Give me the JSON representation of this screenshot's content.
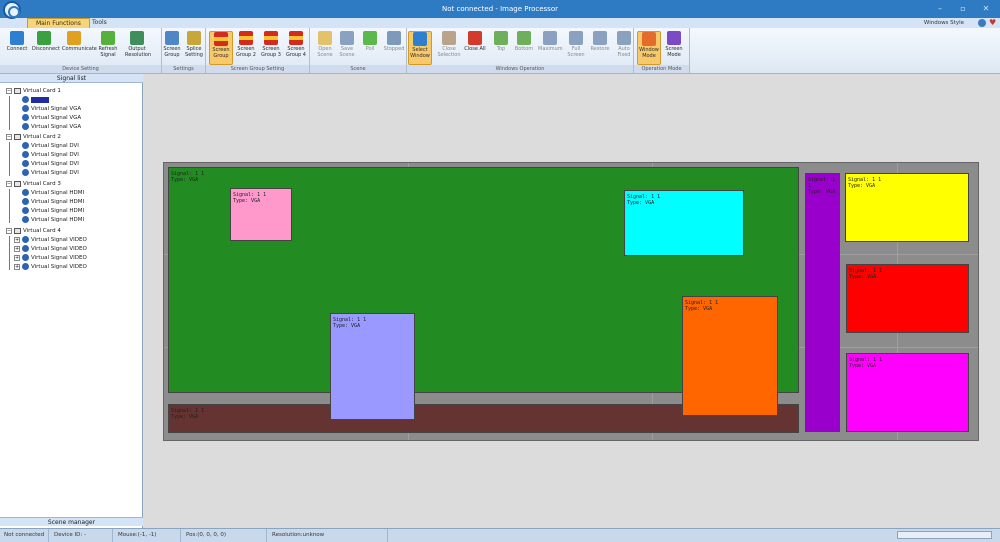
{
  "app": {
    "window_title": "Not connected - Image Processor",
    "min_glyph": "–",
    "max_glyph": "▫",
    "close_glyph": "✕"
  },
  "tabs": [
    "Main Functions",
    "Tools"
  ],
  "theme_label": "Windows Style",
  "ribbon": {
    "groups": [
      {
        "label": "Device Setting",
        "buttons": [
          {
            "label": "Connect",
            "icon": "globe-connect-icon",
            "color": "#2f7fd0"
          },
          {
            "label": "Disconnect",
            "icon": "globe-disconnect-icon",
            "color": "#3aa040"
          },
          {
            "label": "Communicate",
            "icon": "person-communicate-icon",
            "color": "#e0a020"
          },
          {
            "label": "Refresh Signal",
            "icon": "recycle-icon",
            "color": "#56b13c"
          },
          {
            "label": "Output Resolution",
            "icon": "resolution-grid-icon",
            "color": "#3f8f5a"
          }
        ]
      },
      {
        "label": "Settings",
        "buttons": [
          {
            "label": "Screen Group",
            "icon": "screen-group-icon",
            "color": "#4f86c6"
          },
          {
            "label": "Splice Setting",
            "icon": "splice-setting-icon",
            "color": "#c7a63a"
          }
        ]
      },
      {
        "label": "Screen Group Setting",
        "buttons": [
          {
            "label": "Screen Group",
            "icon": "flag-icon",
            "active": true
          },
          {
            "label": "Screen Group 2",
            "icon": "flag-icon"
          },
          {
            "label": "Screen Group 3",
            "icon": "flag-icon"
          },
          {
            "label": "Screen Group 4",
            "icon": "flag-icon"
          }
        ]
      },
      {
        "label": "Scene",
        "buttons": [
          {
            "label": "Open Scene",
            "icon": "folder-open-icon",
            "color": "#e3c26b",
            "dim": true
          },
          {
            "label": "Save Scene",
            "icon": "save-disk-icon",
            "color": "#8aa2bf",
            "dim": true
          },
          {
            "label": "Poll",
            "icon": "poll-cycle-icon",
            "color": "#5bb84b",
            "dim": true
          },
          {
            "label": "Stopped",
            "icon": "stop-icon",
            "color": "#7d9ab8",
            "dim": true
          }
        ]
      },
      {
        "label": "Windows Operation",
        "buttons": [
          {
            "label": "Select Window",
            "icon": "select-window-icon",
            "color": "#2f7fd0",
            "active": true
          },
          {
            "label": "Close Selection",
            "icon": "eraser-icon",
            "color": "#b9a48a",
            "dim": true
          },
          {
            "label": "Close All",
            "icon": "close-all-icon",
            "color": "#d33a2c"
          },
          {
            "label": "Top",
            "icon": "arrow-up-icon",
            "color": "#6fae5a",
            "dim": true
          },
          {
            "label": "Bottom",
            "icon": "arrow-down-icon",
            "color": "#6fae5a",
            "dim": true
          },
          {
            "label": "Maximum",
            "icon": "maximize-monitor-icon",
            "color": "#8aa2bf",
            "dim": true
          },
          {
            "label": "Full Screen",
            "icon": "fullscreen-icon",
            "color": "#8aa2bf",
            "dim": true
          },
          {
            "label": "Restore",
            "icon": "restore-icon",
            "color": "#8aa2bf",
            "dim": true
          },
          {
            "label": "Auto Fixed",
            "icon": "auto-fixed-icon",
            "color": "#8aa2bf",
            "dim": true
          }
        ]
      },
      {
        "label": "Operation Mode",
        "buttons": [
          {
            "label": "Window Mode",
            "icon": "window-mode-icon",
            "color": "#e36b2c",
            "active": true
          },
          {
            "label": "Screen Mode",
            "icon": "screen-mode-icon",
            "color": "#7b4bc7"
          }
        ]
      }
    ]
  },
  "signal_list": {
    "header": "Signal list",
    "footer": "Scene manager",
    "cards": [
      {
        "label": "Virtual Card 1",
        "signals": [
          "",
          "Virtual Signal VGA",
          "Virtual Signal VGA",
          "Virtual Signal VGA"
        ]
      },
      {
        "label": "Virtual Card 2",
        "signals": [
          "Virtual Signal DVI",
          "Virtual Signal DVI",
          "Virtual Signal DVI",
          "Virtual Signal DVI"
        ]
      },
      {
        "label": "Virtual Card 3",
        "signals": [
          "Virtual Signal HDMI",
          "Virtual Signal HDMI",
          "Virtual Signal HDMI",
          "Virtual Signal HDMI"
        ]
      },
      {
        "label": "Virtual Card 4",
        "signals": [
          "Virtual Signal VIDEO",
          "Virtual Signal VIDEO",
          "Virtual Signal VIDEO",
          "Virtual Signal VIDEO"
        ]
      }
    ]
  },
  "canvas": {
    "windows": [
      {
        "id": "green",
        "signal": "Signal: 1 1",
        "type": "Type: VGA",
        "color": "#228b22"
      },
      {
        "id": "maroon",
        "signal": "Signal: 1 1",
        "type": "Type: VGA",
        "color": "#663333"
      },
      {
        "id": "pink",
        "signal": "Signal: 1 1",
        "type": "Type: VGA",
        "color": "#ff99cc"
      },
      {
        "id": "cyan",
        "signal": "Signal: 1 1",
        "type": "Type: VGA",
        "color": "#00ffff"
      },
      {
        "id": "lavender",
        "signal": "Signal: 1 1",
        "type": "Type: VGA",
        "color": "#9999ff"
      },
      {
        "id": "orange",
        "signal": "Signal: 1 1",
        "type": "Type: VGA",
        "color": "#ff6600"
      },
      {
        "id": "purple",
        "signal": "Signal: 1 1",
        "type": "Type: VGA",
        "color": "#9900cc"
      },
      {
        "id": "yellow",
        "signal": "Signal: 1 1",
        "type": "Type: VGA",
        "color": "#ffff00"
      },
      {
        "id": "red",
        "signal": "Signal: 1 1",
        "type": "Type: VGA",
        "color": "#ff0000"
      },
      {
        "id": "magenta",
        "signal": "Signal: 1 1",
        "type": "Type: VGA",
        "color": "#ff00ff"
      }
    ]
  },
  "status": {
    "connection": "Not connected",
    "device_id": "Device ID: -",
    "mouse": "Mouse:(-1, -1)",
    "pos": "Pos:(0, 0, 0, 0)",
    "resolution": "Resolution:unknow"
  }
}
